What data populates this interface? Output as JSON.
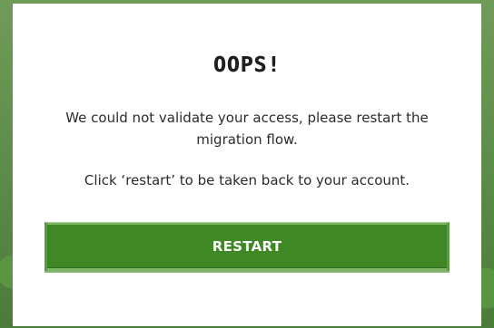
{
  "dialog": {
    "title": "OOPS!",
    "message": "We could not validate your access, please restart the migration flow.",
    "submessage": "Click ‘restart’ to be taken back to your account.",
    "button_label": "RESTART"
  },
  "colors": {
    "modal_background": "#ffffff",
    "text": "#2b2b2b",
    "button": "#3f8825",
    "button_text": "#ffffff"
  }
}
